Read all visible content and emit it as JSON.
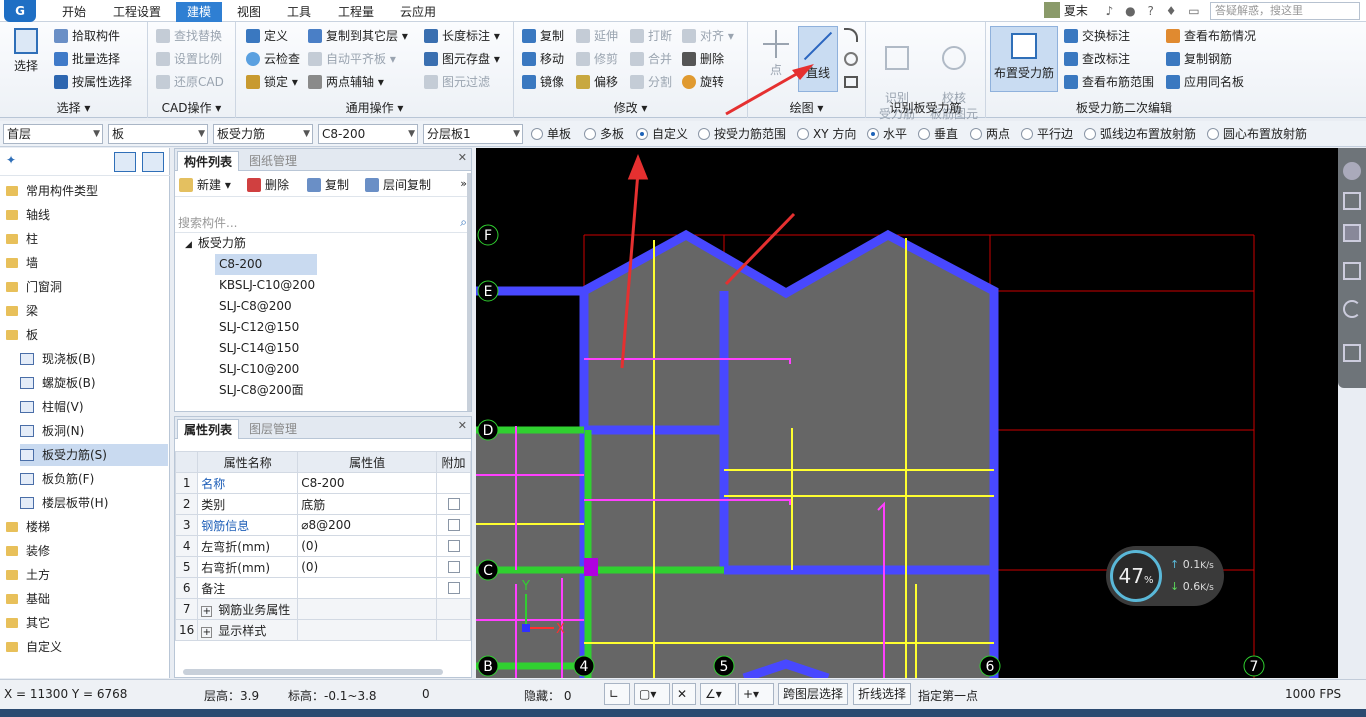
{
  "logo_text": "G",
  "tabs": [
    "开始",
    "工程设置",
    "建模",
    "视图",
    "工具",
    "工程量",
    "云应用"
  ],
  "active_tab": "建模",
  "user": {
    "name": "夏末",
    "search_placeholder": "答疑解惑，搜这里"
  },
  "ribbon": {
    "select": {
      "big": "选择",
      "items": [
        "拾取构件",
        "批量选择",
        "按属性选择"
      ],
      "label": "选择 ▾"
    },
    "cad": {
      "items": [
        "查找替换",
        "设置比例",
        "还原CAD"
      ],
      "label": "CAD操作 ▾"
    },
    "common": {
      "col1": [
        "定义",
        "云检查",
        "锁定 ▾"
      ],
      "col2": [
        "复制到其它层 ▾",
        "自动平齐板 ▾",
        "两点辅轴 ▾"
      ],
      "col3": [
        "长度标注 ▾",
        "图元存盘 ▾",
        "图元过滤"
      ],
      "label": "通用操作 ▾"
    },
    "modify": {
      "col1": [
        "复制",
        "移动",
        "镜像"
      ],
      "col2": [
        "延伸",
        "修剪",
        "偏移"
      ],
      "col3": [
        "打断",
        "合并",
        "分割"
      ],
      "col4": [
        "对齐 ▾",
        "删除",
        "旋转"
      ],
      "label": "修改 ▾"
    },
    "draw": {
      "point": "点",
      "line": "直线",
      "label": "绘图 ▾"
    },
    "identify": {
      "b1": "识别\n受力筋",
      "b2": "校核\n板筋图元",
      "label": "识别板受力筋"
    },
    "edit2": {
      "big": "布置受力筋",
      "col1": [
        "交换标注",
        "查改标注",
        "查看布筋范围"
      ],
      "col2": [
        "查看布筋情况",
        "复制钢筋",
        "应用同名板"
      ],
      "label": "板受力筋二次编辑"
    }
  },
  "options": {
    "combos": [
      "首层",
      "板",
      "板受力筋",
      "C8-200",
      "分层板1"
    ],
    "radios": [
      {
        "label": "单板",
        "on": false
      },
      {
        "label": "多板",
        "on": false
      },
      {
        "label": "自定义",
        "on": true
      },
      {
        "label": "按受力筋范围",
        "on": false
      },
      {
        "label": "XY 方向",
        "on": false
      },
      {
        "label": "水平",
        "on": true
      },
      {
        "label": "垂直",
        "on": false
      },
      {
        "label": "两点",
        "on": false
      },
      {
        "label": "平行边",
        "on": false
      },
      {
        "label": "弧线边布置放射筋",
        "on": false
      },
      {
        "label": "圆心布置放射筋",
        "on": false
      }
    ]
  },
  "tree": [
    {
      "label": "常用构件类型",
      "type": "folder"
    },
    {
      "label": "轴线",
      "type": "folder"
    },
    {
      "label": "柱",
      "type": "folder"
    },
    {
      "label": "墙",
      "type": "folder"
    },
    {
      "label": "门窗洞",
      "type": "folder"
    },
    {
      "label": "梁",
      "type": "folder"
    },
    {
      "label": "板",
      "type": "folder"
    },
    {
      "label": "现浇板(B)",
      "type": "leaf"
    },
    {
      "label": "螺旋板(B)",
      "type": "leaf"
    },
    {
      "label": "柱帽(V)",
      "type": "leaf"
    },
    {
      "label": "板洞(N)",
      "type": "leaf"
    },
    {
      "label": "板受力筋(S)",
      "type": "leaf",
      "selected": true
    },
    {
      "label": "板负筋(F)",
      "type": "leaf"
    },
    {
      "label": "楼层板带(H)",
      "type": "leaf"
    },
    {
      "label": "楼梯",
      "type": "folder"
    },
    {
      "label": "装修",
      "type": "folder"
    },
    {
      "label": "土方",
      "type": "folder"
    },
    {
      "label": "基础",
      "type": "folder"
    },
    {
      "label": "其它",
      "type": "folder"
    },
    {
      "label": "自定义",
      "type": "folder"
    }
  ],
  "comp": {
    "tab_on": "构件列表",
    "tab_off": "图纸管理",
    "tools": [
      "新建 ▾",
      "删除",
      "复制",
      "层间复制"
    ],
    "search_placeholder": "搜索构件...",
    "root": "板受力筋",
    "items": [
      "C8-200",
      "KBSLJ-C10@200",
      "SLJ-C8@200",
      "SLJ-C12@150",
      "SLJ-C14@150",
      "SLJ-C10@200",
      "SLJ-C8@200面"
    ]
  },
  "props": {
    "tab_on": "属性列表",
    "tab_off": "图层管理",
    "headers": [
      "属性名称",
      "属性值",
      "附加"
    ],
    "rows": [
      {
        "n": "1",
        "name": "名称",
        "value": "C8-200",
        "blue": true,
        "cb": false
      },
      {
        "n": "2",
        "name": "类别",
        "value": "底筋",
        "blue": false,
        "cb": true
      },
      {
        "n": "3",
        "name": "钢筋信息",
        "value": "⌀8@200",
        "blue": true,
        "cb": true
      },
      {
        "n": "4",
        "name": "左弯折(mm)",
        "value": "(0)",
        "blue": false,
        "cb": true
      },
      {
        "n": "5",
        "name": "右弯折(mm)",
        "value": "(0)",
        "blue": false,
        "cb": true
      },
      {
        "n": "6",
        "name": "备注",
        "value": "",
        "blue": false,
        "cb": true
      },
      {
        "n": "7",
        "name": "钢筋业务属性",
        "value": "",
        "blue": false,
        "cb": false,
        "group": true
      },
      {
        "n": "16",
        "name": "显示样式",
        "value": "",
        "blue": false,
        "cb": false,
        "group": true
      }
    ]
  },
  "axes": {
    "rows": [
      "F",
      "E",
      "D",
      "C",
      "B"
    ],
    "cols": [
      "4",
      "5",
      "6",
      "7"
    ]
  },
  "net": {
    "percent": "47",
    "unit": "%",
    "up": "0.1",
    "down": "0.6",
    "rate_unit": "K/s"
  },
  "status": {
    "coords": "X = 11300 Y = 6768",
    "floor_h": "层高：3.9",
    "elev": "标高：-0.1~3.8",
    "zero": "0",
    "hidden": "隐藏：  0",
    "btn1": "跨图层选择",
    "btn2": "折线选择",
    "prompt": "指定第一点",
    "fps": "1000 FPS"
  },
  "colors": {
    "accent": "#2f7fd3",
    "slab": "#666666",
    "beam_blue": "#4848ff",
    "magenta": "#ff40ff",
    "yellow": "#ffff30",
    "green": "#30d030",
    "grid_red": "#cc0000",
    "arrow": "#e53030"
  }
}
